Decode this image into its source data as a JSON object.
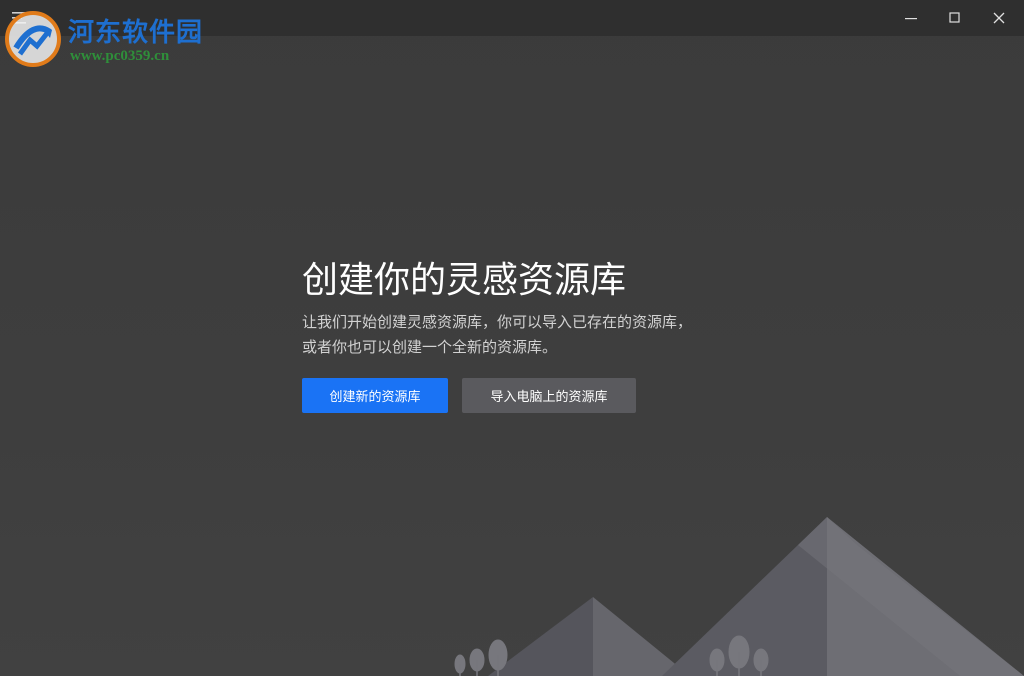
{
  "watermark": {
    "title": "河东软件园",
    "url": "www.pc0359.cn"
  },
  "titlebar": {
    "menu_icon": "hamburger-icon",
    "minimize_icon": "minimize-icon",
    "maximize_icon": "maximize-icon",
    "close_icon": "close-icon"
  },
  "main": {
    "heading": "创建你的灵感资源库",
    "description_lines": [
      "让我们开始创建灵感资源库，你可以导入已存在的资源库，",
      "或者你也可以创建一个全新的资源库。"
    ],
    "create_button": "创建新的资源库",
    "import_button": "导入电脑上的资源库"
  },
  "colors": {
    "background": "#3e3e3e",
    "titlebar": "#2f2f2f",
    "primary_button": "#1a73f5",
    "secondary_button": "#5a5a5e",
    "mountain_light": "#6e6e74",
    "mountain_dark": "#55555c"
  }
}
